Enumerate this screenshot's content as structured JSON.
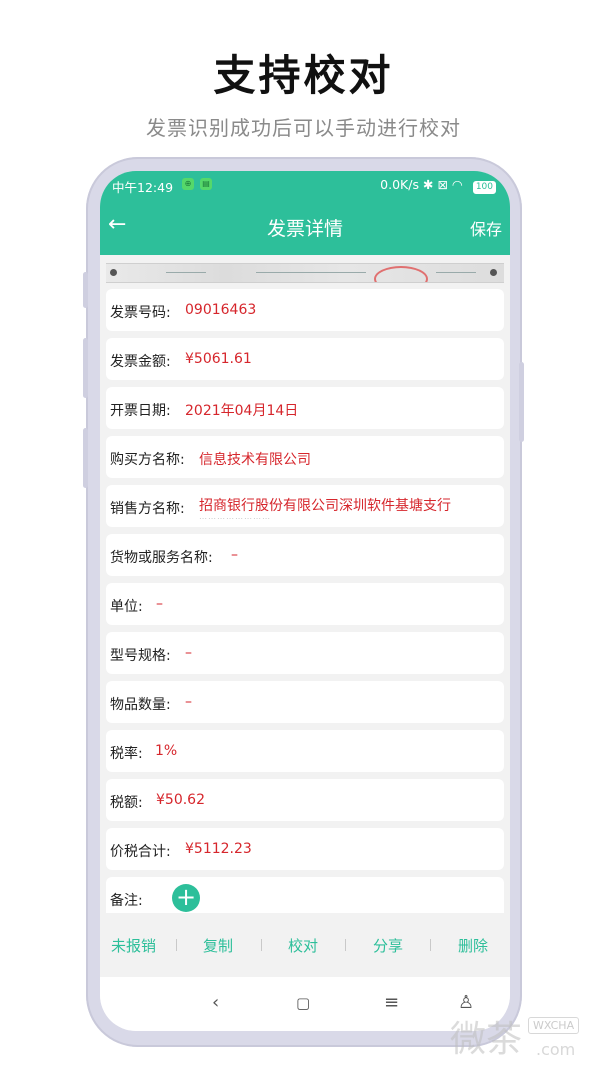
{
  "promo": {
    "headline": "支持校对",
    "subline": "发票识别成功后可以手动进行校对"
  },
  "status_bar": {
    "time": "中午12:49",
    "speed": "0.0K/s",
    "battery": "100"
  },
  "nav": {
    "title": "发票详情",
    "save_label": "保存"
  },
  "fields": [
    {
      "label": "发票号码:",
      "value": "09016463"
    },
    {
      "label": "发票金额:",
      "value": "¥5061.61"
    },
    {
      "label": "开票日期:",
      "value": "2021年04月14日"
    },
    {
      "label": "购买方名称:",
      "value": "信息技术有限公司"
    },
    {
      "label": "销售方名称:",
      "value": "招商银行股份有限公司深圳软件基塘支行"
    },
    {
      "label": "货物或服务名称:",
      "value": "–"
    },
    {
      "label": "单位:",
      "value": "–"
    },
    {
      "label": "型号规格:",
      "value": "–"
    },
    {
      "label": "物品数量:",
      "value": "–"
    },
    {
      "label": "税率:",
      "value": "1%"
    },
    {
      "label": "税额:",
      "value": "¥50.62"
    },
    {
      "label": "价税合计:",
      "value": "¥5112.23"
    },
    {
      "label": "备注:"
    }
  ],
  "actions": {
    "unreimbursed": "未报销",
    "copy": "复制",
    "proofread": "校对",
    "share": "分享",
    "delete": "删除"
  },
  "icons": {
    "back": "arrow-left-icon",
    "add": "plus-icon",
    "sys_back": "chevron-left-icon",
    "sys_home": "square-icon",
    "sys_recent": "menu-icon",
    "sys_access": "accessibility-icon"
  },
  "colors": {
    "accent": "#2dbf9a",
    "value_red": "#d6262c"
  },
  "watermark": {
    "text": "微茶",
    "badge": "WXCHA",
    "domain": ".com"
  }
}
